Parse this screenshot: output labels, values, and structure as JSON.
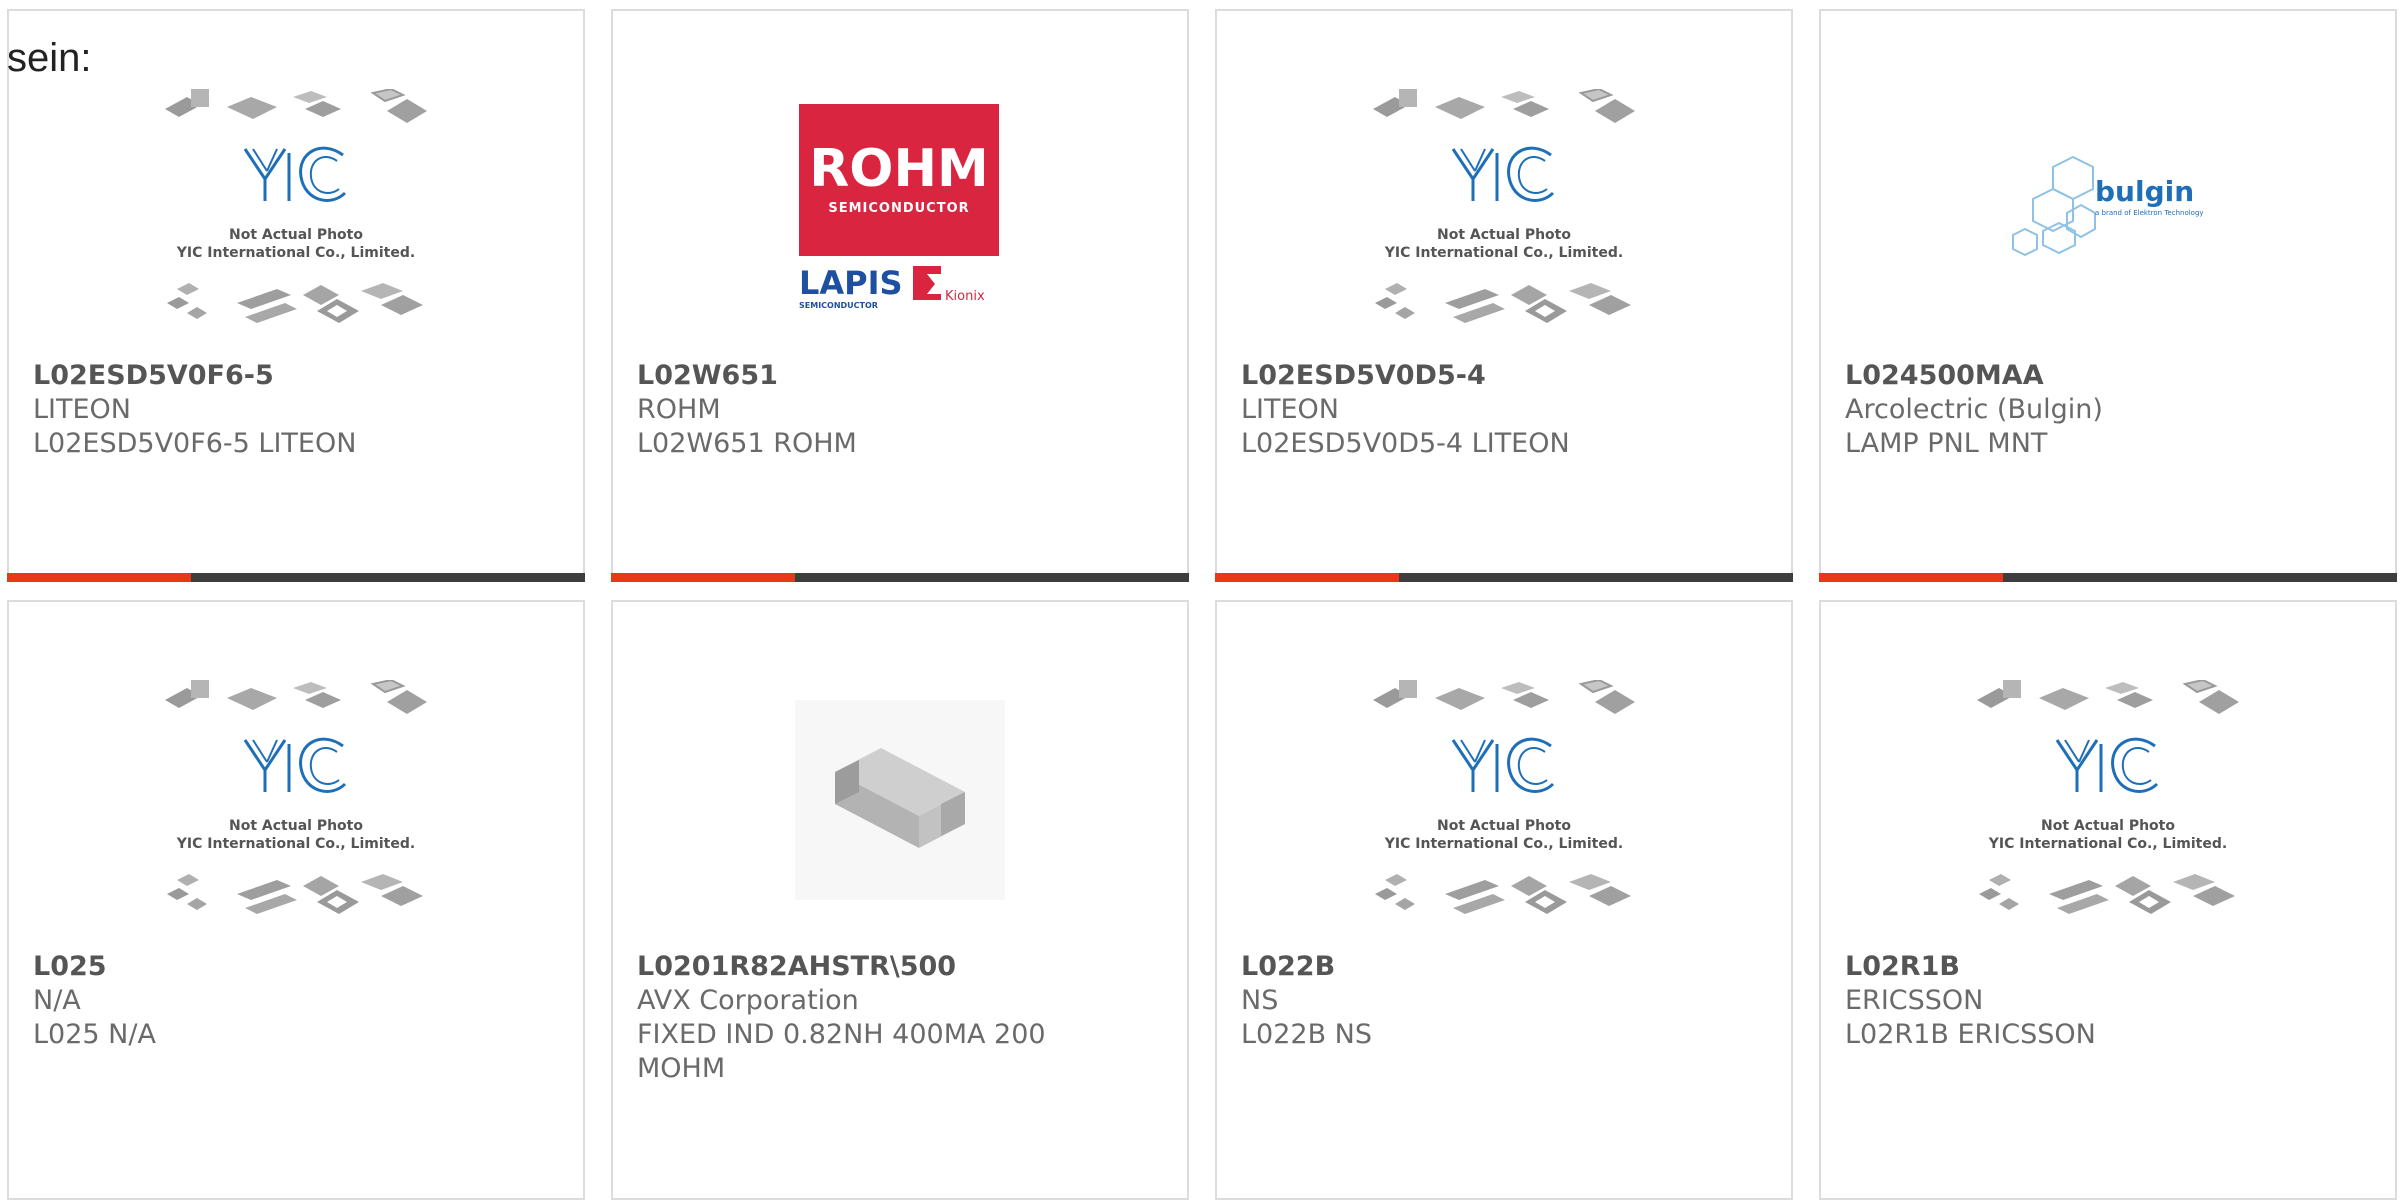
{
  "intro_text": "sein:",
  "colors": {
    "accent": "#e8381b",
    "bar": "#3e3e3e",
    "border": "#dcdcdc",
    "rohm_red": "#d9253f",
    "yic_blue": "#1e6fb8"
  },
  "placeholder": {
    "line1": "Not Actual Photo",
    "line2": "YIC International Co., Limited.",
    "brand": "YIC"
  },
  "rohm_logo": {
    "brand": "ROHM",
    "sub": "SEMICONDUCTOR",
    "lapis": "LAPIS",
    "lapis_sub": "SEMICONDUCTOR",
    "kionix": "Kionix"
  },
  "bulgin_logo": {
    "brand": "bulgin",
    "tagline": "a brand of Elektron Technology"
  },
  "products": [
    {
      "part": "L02ESD5V0F6-5",
      "manufacturer": "LITEON",
      "description": "L02ESD5V0F6-5 LITEON",
      "image": "yic-placeholder"
    },
    {
      "part": "L02W651",
      "manufacturer": "ROHM",
      "description": "L02W651 ROHM",
      "image": "rohm-logo"
    },
    {
      "part": "L02ESD5V0D5-4",
      "manufacturer": "LITEON",
      "description": "L02ESD5V0D5-4 LITEON",
      "image": "yic-placeholder"
    },
    {
      "part": "L024500MAA",
      "manufacturer": "Arcolectric (Bulgin)",
      "description": "LAMP PNL MNT",
      "image": "bulgin-logo"
    },
    {
      "part": "L025",
      "manufacturer": "N/A",
      "description": "L025 N/A",
      "image": "yic-placeholder"
    },
    {
      "part": "L0201R82AHSTR\\500",
      "manufacturer": "AVX Corporation",
      "description": "FIXED IND 0.82NH 400MA 200 MOHM",
      "image": "chip-component"
    },
    {
      "part": "L022B",
      "manufacturer": "NS",
      "description": "L022B NS",
      "image": "yic-placeholder"
    },
    {
      "part": "L02R1B",
      "manufacturer": "ERICSSON",
      "description": "L02R1B ERICSSON",
      "image": "yic-placeholder"
    }
  ]
}
